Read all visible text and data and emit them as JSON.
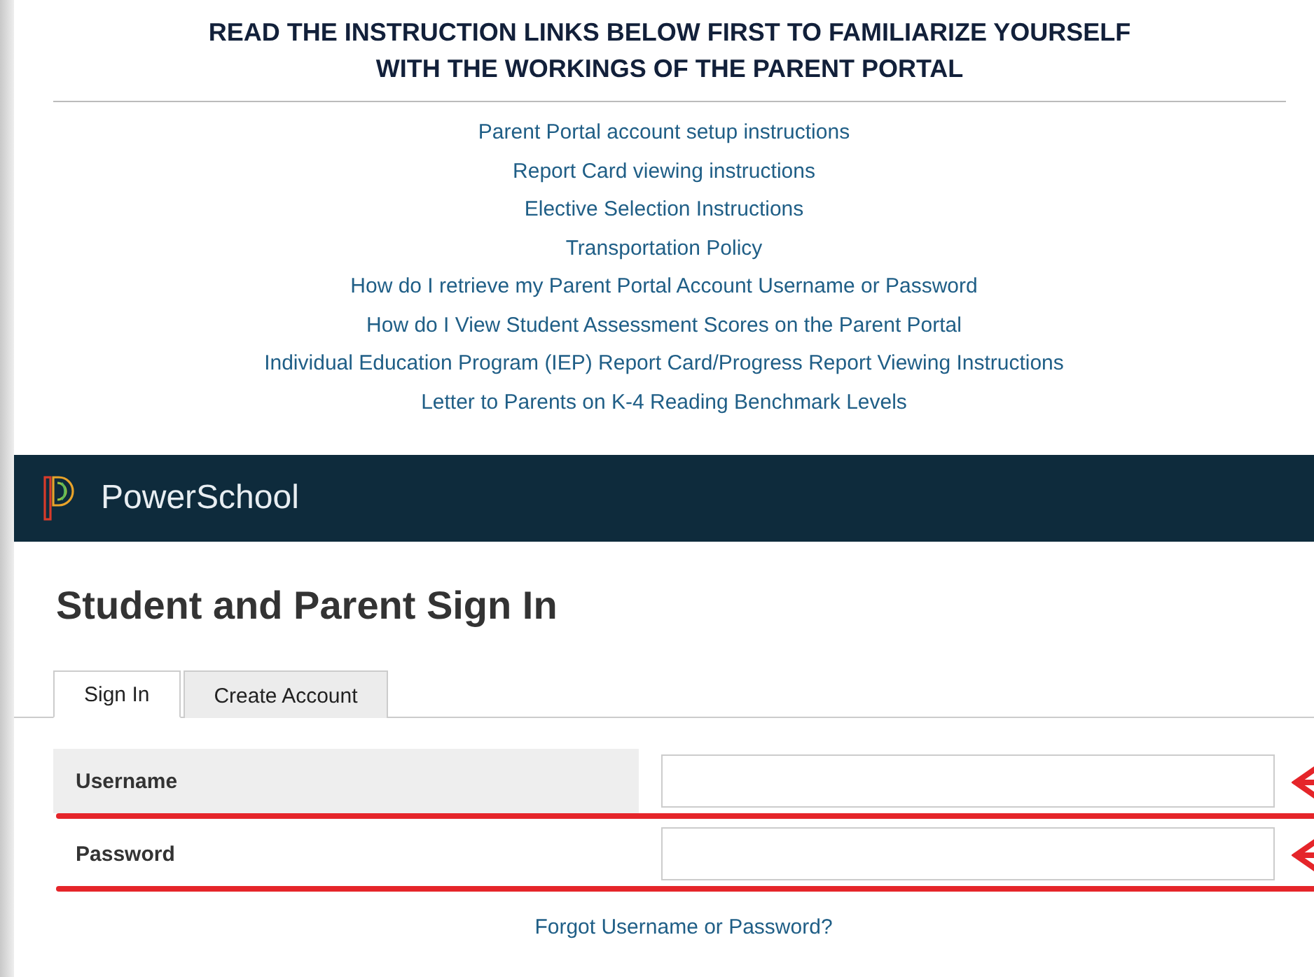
{
  "notice": {
    "title": "READ THE INSTRUCTION LINKS BELOW FIRST TO FAMILIARIZE YOURSELF WITH THE WORKINGS OF THE PARENT PORTAL"
  },
  "links": [
    "Parent Portal account setup instructions",
    "Report Card viewing instructions",
    "Elective Selection Instructions",
    "Transportation Policy",
    "How do I retrieve my Parent Portal Account Username or Password",
    "How do I View Student Assessment Scores on the Parent Portal",
    "Individual Education Program (IEP) Report Card/Progress Report Viewing Instructions",
    "Letter to Parents on K-4 Reading Benchmark Levels"
  ],
  "banner": {
    "brand": "PowerSchool"
  },
  "heading": "Student and Parent Sign In",
  "tabs": [
    {
      "label": "Sign In",
      "selected": true
    },
    {
      "label": "Create Account",
      "selected": false
    }
  ],
  "fields": [
    {
      "label": "Username",
      "shaded": true
    },
    {
      "label": "Password",
      "shaded": false
    }
  ],
  "forgot_link": "Forgot Username or Password?"
}
